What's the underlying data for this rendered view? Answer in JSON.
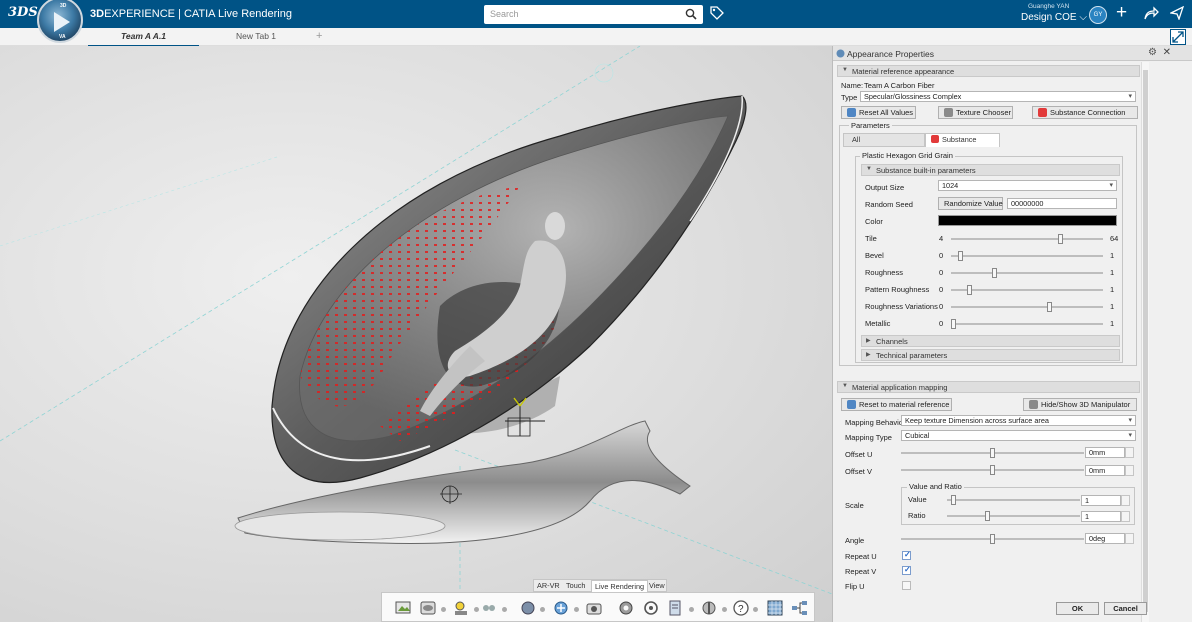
{
  "topbar": {
    "logo": "3DS",
    "brand_bold": "3D",
    "brand_rest": "EXPERIENCE | CATIA",
    "app": "Live Rendering",
    "search_placeholder": "Search",
    "user_name": "Guanghe YAN",
    "workspace": "Design COE",
    "avatar_initials": "GY",
    "accent": "#005386"
  },
  "compass": {
    "n": "3D",
    "w": "",
    "e": "",
    "s": "VA"
  },
  "tabs": [
    {
      "label": "Team A A.1",
      "active": true
    },
    {
      "label": "New Tab 1",
      "active": false
    }
  ],
  "panel": {
    "title": "Appearance Properties",
    "material_ref": {
      "header": "Material reference appearance",
      "name_label": "Name:",
      "name_value": "Team A Carbon Fiber",
      "type_label": "Type",
      "type_value": "Specular/Glossiness Complex",
      "reset_all": "Reset All Values",
      "texture_chooser": "Texture Chooser",
      "substance_connection": "Substance Connection"
    },
    "parameters": {
      "group_label": "Parameters",
      "tab_all": "All",
      "tab_substance": "Substance",
      "substance_group": "Plastic Hexagon Grid Grain",
      "builtin_header": "Substance built-in parameters",
      "output_size_label": "Output Size",
      "output_size_value": "1024",
      "random_seed_label": "Random Seed",
      "randomize_btn": "Randomize Value",
      "random_seed_value": "00000000",
      "color_label": "Color",
      "color_value": "#000000",
      "sliders": [
        {
          "label": "Tile",
          "min": "4",
          "max": "64",
          "fraction": 0.73
        },
        {
          "label": "Bevel",
          "min": "0",
          "max": "1",
          "fraction": 0.05
        },
        {
          "label": "Roughness",
          "min": "0",
          "max": "1",
          "fraction": 0.28
        },
        {
          "label": "Pattern Roughness",
          "min": "0",
          "max": "1",
          "fraction": 0.11
        },
        {
          "label": "Roughness Variations",
          "min": "0",
          "max": "1",
          "fraction": 0.65
        },
        {
          "label": "Metallic",
          "min": "0",
          "max": "1",
          "fraction": 0.0
        }
      ],
      "channels": "Channels",
      "technical": "Technical parameters"
    },
    "mapping": {
      "header": "Material application mapping",
      "reset_btn": "Reset to material reference",
      "manip_btn": "Hide/Show 3D Manipulator",
      "behavior_label": "Mapping Behavio",
      "behavior_value": "Keep texture Dimension across surface area",
      "type_label": "Mapping Type",
      "type_value": "Cubical",
      "offset_u_label": "Offset U",
      "offset_u_value": "0mm",
      "offset_u_fraction": 0.5,
      "offset_v_label": "Offset V",
      "offset_v_value": "0mm",
      "offset_v_fraction": 0.5,
      "scale_label": "Scale",
      "scale_group": "Value and Ratio",
      "value_label": "Value",
      "value_value": "1",
      "value_fraction": 0.03,
      "ratio_label": "Ratio",
      "ratio_value": "1",
      "ratio_fraction": 0.3,
      "angle_label": "Angle",
      "angle_value": "0deg",
      "angle_fraction": 0.5,
      "repeat_u_label": "Repeat U",
      "repeat_u": true,
      "repeat_v_label": "Repeat V",
      "repeat_v": true,
      "flip_u_label": "Flip U",
      "flip_u": false
    },
    "ok": "OK",
    "cancel": "Cancel"
  },
  "bottom_tabs": [
    "AR-VR",
    "Touch",
    "Live Rendering",
    "View"
  ],
  "bottom_active": "Live Rendering",
  "toolbar_icons": [
    "render-icon",
    "environment-icon",
    "lights-icon",
    "camera-icon",
    "material-icon",
    "snapshot-icon",
    "realtime-icon",
    "settings-icon",
    "catalog-icon",
    "tools-icon",
    "help-icon",
    "texture-icon",
    "tree-icon"
  ]
}
